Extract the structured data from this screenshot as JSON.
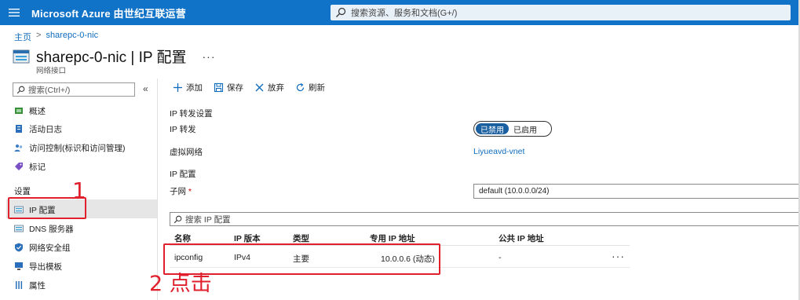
{
  "topbar": {
    "brand": "Microsoft Azure 由世纪互联运营",
    "search_placeholder": "搜索资源、服务和文档(G+/)"
  },
  "breadcrumb": {
    "home": "主页",
    "current": "sharepc-0-nic"
  },
  "header": {
    "title": "sharepc-0-nic | IP 配置",
    "more": "···",
    "subtitle": "网络接口"
  },
  "sidebar": {
    "search_placeholder": "搜索(Ctrl+/)",
    "collapse": "«",
    "items": [
      {
        "label": "概述",
        "icon": "overview-icon"
      },
      {
        "label": "活动日志",
        "icon": "activity-log-icon"
      },
      {
        "label": "访问控制(标识和访问管理)",
        "icon": "access-control-icon"
      },
      {
        "label": "标记",
        "icon": "tag-icon"
      }
    ],
    "section_settings": "设置",
    "settings_items": [
      {
        "label": "IP 配置",
        "icon": "ip-config-icon",
        "active": true
      },
      {
        "label": "DNS 服务器",
        "icon": "dns-icon"
      },
      {
        "label": "网络安全组",
        "icon": "nsg-icon"
      },
      {
        "label": "导出模板",
        "icon": "export-icon"
      },
      {
        "label": "属性",
        "icon": "properties-icon"
      }
    ]
  },
  "toolbar": {
    "add": "添加",
    "save": "保存",
    "discard": "放弃",
    "refresh": "刷新"
  },
  "content": {
    "ip_forward_heading": "IP 转发设置",
    "ip_forward_label": "IP 转发",
    "toggle_on": "已禁用",
    "toggle_off": "已启用",
    "vnet_label": "虚拟网络",
    "vnet_value": "Liyueavd-vnet",
    "ip_config_heading": "IP 配置",
    "subnet_label": "子网",
    "subnet_required": "*",
    "subnet_value": "default (10.0.0.0/24)",
    "ip_search_placeholder": "搜索 IP 配置"
  },
  "table": {
    "headers": [
      "名称",
      "IP 版本",
      "类型",
      "专用 IP 地址",
      "公共 IP 地址"
    ],
    "rows": [
      {
        "name": "ipconfig",
        "version": "IPv4",
        "type": "主要",
        "private_ip": "10.0.0.6 (动态)",
        "public_ip": "-",
        "more": "···"
      }
    ]
  },
  "annotations": {
    "step1": "1",
    "step2": "2 点击"
  },
  "colors": {
    "topbar": "#1173c7",
    "link": "#0f6cbd",
    "annotation": "#e0202c"
  }
}
